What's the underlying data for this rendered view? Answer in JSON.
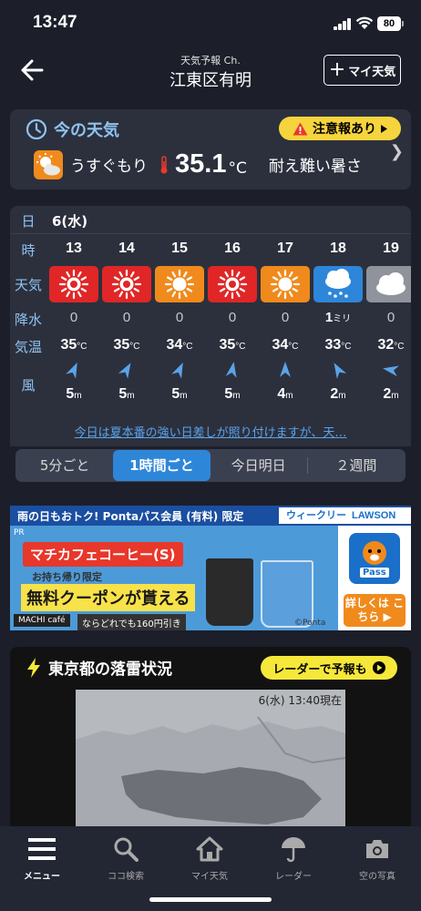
{
  "status": {
    "time": "13:47",
    "battery": "80"
  },
  "header": {
    "subtitle": "天気予報 Ch.",
    "title": "江東区有明",
    "my_weather_label": "マイ天気"
  },
  "current": {
    "heading": "今の天気",
    "alert_label": "注意報あり",
    "condition": "うすぐもり",
    "temperature": "35.1",
    "unit": "°C",
    "description": "耐え難い暑さ"
  },
  "hourly": {
    "labels": {
      "date": "日",
      "hour": "時",
      "weather": "天気",
      "precip": "降水",
      "temp": "気温",
      "wind": "風"
    },
    "date": "6(水)",
    "temp_unit": "°C",
    "wind_unit": "m",
    "hours": [
      {
        "hour": "13",
        "weather_icon": "sun-hot-icon",
        "bg": "#e02626",
        "precip": "0",
        "temp": "35",
        "wind_speed": "5",
        "wind_dir_deg": 25
      },
      {
        "hour": "14",
        "weather_icon": "sun-hot-icon",
        "bg": "#e02626",
        "precip": "0",
        "temp": "35",
        "wind_speed": "5",
        "wind_dir_deg": 30
      },
      {
        "hour": "15",
        "weather_icon": "sun-icon",
        "bg": "#f08a1c",
        "precip": "0",
        "temp": "34",
        "wind_speed": "5",
        "wind_dir_deg": 25
      },
      {
        "hour": "16",
        "weather_icon": "sun-hot-icon",
        "bg": "#e02626",
        "precip": "0",
        "temp": "35",
        "wind_speed": "5",
        "wind_dir_deg": 10
      },
      {
        "hour": "17",
        "weather_icon": "sun-icon",
        "bg": "#f08a1c",
        "precip": "0",
        "temp": "34",
        "wind_speed": "4",
        "wind_dir_deg": 0
      },
      {
        "hour": "18",
        "weather_icon": "rain-cloud-icon",
        "bg": "#2e86d9",
        "precip": "1",
        "precip_unit": "ミリ",
        "temp": "33",
        "wind_speed": "2",
        "wind_dir_deg": -30
      },
      {
        "hour": "19",
        "weather_icon": "cloud-icon",
        "bg": "#8e939c",
        "precip": "0",
        "temp": "32",
        "wind_speed": "2",
        "wind_dir_deg": -80
      }
    ]
  },
  "comment": "今日は夏本番の強い日差しが照り付けますが、天…",
  "segments": [
    "5分ごと",
    "1時間ごと",
    "今日明日",
    "２週間"
  ],
  "ad": {
    "top_text": "雨の日もおトク! Pontaパス会員 (有料) 限定",
    "weekly": "ウィークリー",
    "lawson": "LAWSON",
    "pr": "PR",
    "cafe": "マチカフェコーヒー(S)",
    "takeout": "お持ち帰り限定",
    "coupon": "無料クーポンが貰える",
    "machi": "MACHI café",
    "anywhere": "ならどれでも160円引き",
    "ponta": "©Ponta",
    "pass": "Pass",
    "detail": "詳しくは こちら ▶"
  },
  "lightning": {
    "title": "東京都の落雷状況",
    "radar_button": "レーダーで予報も",
    "map_time": "6(水) 13:40現在"
  },
  "tabs": [
    {
      "label": "メニュー",
      "icon": "menu-icon"
    },
    {
      "label": "ココ検索",
      "icon": "search-icon"
    },
    {
      "label": "マイ天気",
      "icon": "home-icon"
    },
    {
      "label": "レーダー",
      "icon": "umbrella-icon"
    },
    {
      "label": "空の写真",
      "icon": "camera-icon"
    }
  ]
}
